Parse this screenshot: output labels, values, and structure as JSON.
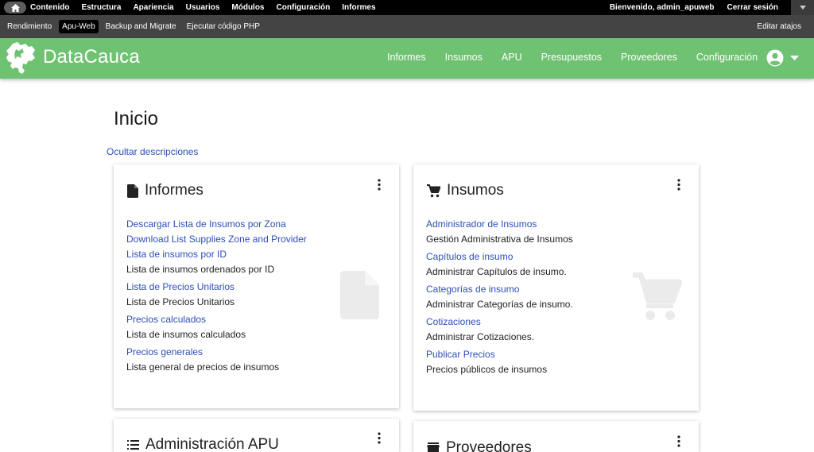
{
  "admin_toolbar": {
    "menu": [
      "Contenido",
      "Estructura",
      "Apariencia",
      "Usuarios",
      "Módulos",
      "Configuración",
      "Informes"
    ],
    "welcome": "Bienvenido, admin_apuweb",
    "logout": "Cerrar sesión"
  },
  "shortcuts": {
    "items": [
      "Rendimiento",
      "Apu-Web",
      "Backup and Migrate",
      "Ejecutar código PHP"
    ],
    "active": "Apu-Web",
    "edit": "Editar atajos"
  },
  "site": {
    "brand": "DataCauca",
    "nav": [
      "Informes",
      "Insumos",
      "APU",
      "Presupuestos",
      "Proveedores",
      "Configuración"
    ],
    "header_color": "#6fc272"
  },
  "page": {
    "title": "Inicio",
    "toggle_descriptions": "Ocultar descripciones",
    "link_color": "#2b4fb8"
  },
  "cards": {
    "informes": {
      "title": "Informes",
      "icon": "file-icon",
      "items": [
        {
          "link": "Descargar Lista de Insumos por Zona",
          "desc": ""
        },
        {
          "link": "Download List Supplies Zone and Provider",
          "desc": ""
        },
        {
          "link": "Lista de insumos por ID",
          "desc": "Lista de insumos ordenados por ID"
        },
        {
          "link": "Lista de Precios Unitarios",
          "desc": "Lista de Precios Unitarios"
        },
        {
          "link": "Precios calculados",
          "desc": "Lista de insumos calculados"
        },
        {
          "link": "Precios generales",
          "desc": "Lista general de precios de insumos"
        }
      ]
    },
    "insumos": {
      "title": "Insumos",
      "icon": "cart-icon",
      "items": [
        {
          "link": "Administrador de Insumos",
          "desc": "Gestión Administrativa de Insumos"
        },
        {
          "link": "Capítulos de insumo",
          "desc": "Administrar Capítulos de insumo."
        },
        {
          "link": "Categorías de insumo",
          "desc": "Administrar Categorías de insumo."
        },
        {
          "link": "Cotizaciones",
          "desc": "Administrar Cotizaciones."
        },
        {
          "link": "Publicar Precios",
          "desc": "Precios públicos de insumos"
        }
      ]
    },
    "apu": {
      "title": "Administración APU",
      "icon": "list-icon"
    },
    "proveedores": {
      "title": "Proveedores",
      "icon": "store-icon"
    }
  }
}
